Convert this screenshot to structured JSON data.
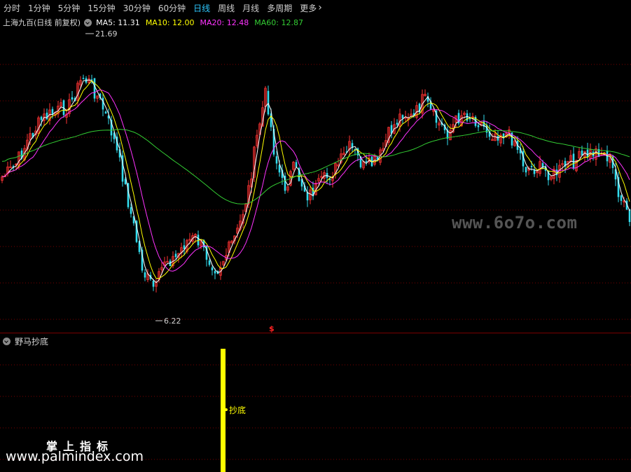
{
  "toolbar": {
    "timeframes": [
      {
        "label": "分时",
        "active": false
      },
      {
        "label": "1分钟",
        "active": false
      },
      {
        "label": "5分钟",
        "active": false
      },
      {
        "label": "15分钟",
        "active": false
      },
      {
        "label": "30分钟",
        "active": false
      },
      {
        "label": "60分钟",
        "active": false
      },
      {
        "label": "日线",
        "active": true
      },
      {
        "label": "周线",
        "active": false
      },
      {
        "label": "月线",
        "active": false
      },
      {
        "label": "多周期",
        "active": false
      },
      {
        "label": "更多",
        "active": false
      }
    ]
  },
  "info": {
    "stock": "上海九百(日线 前复权)",
    "ma": [
      {
        "label": "MA5: 11.31",
        "color": "#ffffff"
      },
      {
        "label": "MA10: 12.00",
        "color": "#ffff00"
      },
      {
        "label": "MA20: 12.48",
        "color": "#ff33ff"
      },
      {
        "label": "MA60: 12.87",
        "color": "#33cc33"
      }
    ]
  },
  "price": {
    "high_label": "21.69",
    "low_label": "6.22",
    "marker": "$"
  },
  "indicator": {
    "title": "野马抄底",
    "signal_label": "抄底",
    "bar_color": "#ffff00"
  },
  "watermark": "www.6o7o.com",
  "brand": {
    "line1": "掌上指标",
    "line2": "www.palmindex.com"
  },
  "colors": {
    "up": "#ff3333",
    "down": "#33ddee",
    "grid": "#7a0000"
  }
}
